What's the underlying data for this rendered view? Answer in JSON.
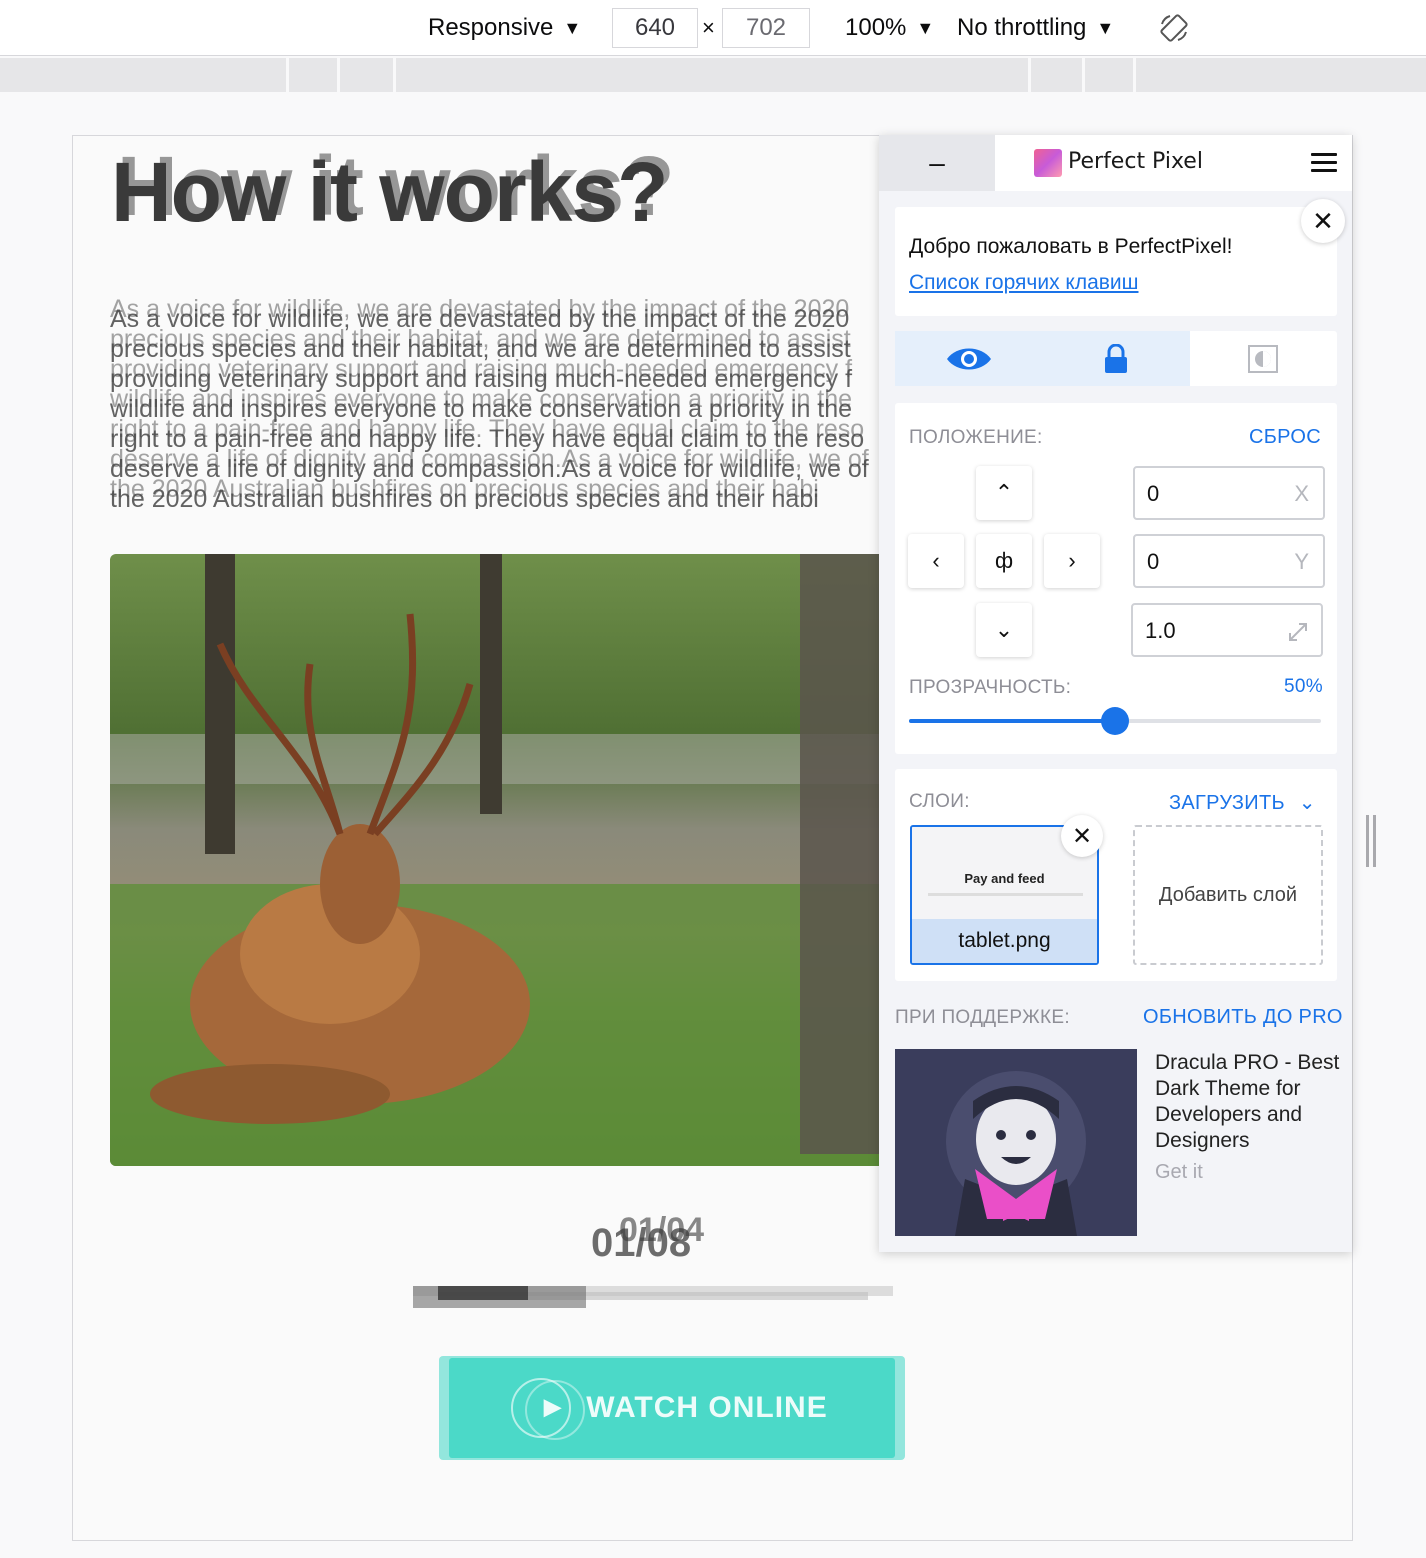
{
  "toolbar": {
    "device": "Responsive",
    "width": "640",
    "height": "702",
    "times": "×",
    "zoom": "100%",
    "throttling": "No throttling"
  },
  "page": {
    "title": "How it works?",
    "body": "As a voice for wildlife, we are devastated by the impact of the 2020 precious species and their habitat, and we are determined to assist providing veterinary support and raising much-needed emergency f wildlife and inspires everyone to make conservation a priority in the right to a pain-free and happy life. They have equal claim to the reso deserve a life of dignity and compassion.As a voice for wildlife, we of the 2020 Australian bushfires on precious species and their habi",
    "counter": "01/08",
    "counter_ghost": "01/04",
    "progress": 0.36,
    "watch_label": "WATCH ONLINE"
  },
  "perfect_pixel": {
    "minimize": "–",
    "title": "Perfect Pixel",
    "welcome": "Добро пожаловать в PerfectPixel!",
    "hotkeys_link": "Список горячих клавиш",
    "close": "✕",
    "position_label": "ПОЛОЖЕНИЕ:",
    "reset": "СБРОС",
    "center_glyph": "ф",
    "x_value": "0",
    "x_suffix": "X",
    "y_value": "0",
    "y_suffix": "Y",
    "scale_value": "1.0",
    "opacity_label": "ПРОЗРАЧНОСТЬ:",
    "opacity_value": "50%",
    "opacity": 0.5,
    "layers_label": "СЛОИ:",
    "upload": "ЗАГРУЗИТЬ",
    "layer_preview_title": "Pay and feed",
    "layer_file": "tablet.png",
    "add_layer": "Добавить слой",
    "sponsor_label": "ПРИ ПОДДЕРЖКЕ:",
    "upgrade": "ОБНОВИТЬ ДО PRO",
    "ad_text": "Dracula PRO - Best Dark Theme for Developers and Designers",
    "ad_cta": "Get it"
  },
  "colors": {
    "accent": "#1a73e8",
    "watch_button": "#3ed6c4",
    "ad_bg": "#3a3d5c"
  }
}
